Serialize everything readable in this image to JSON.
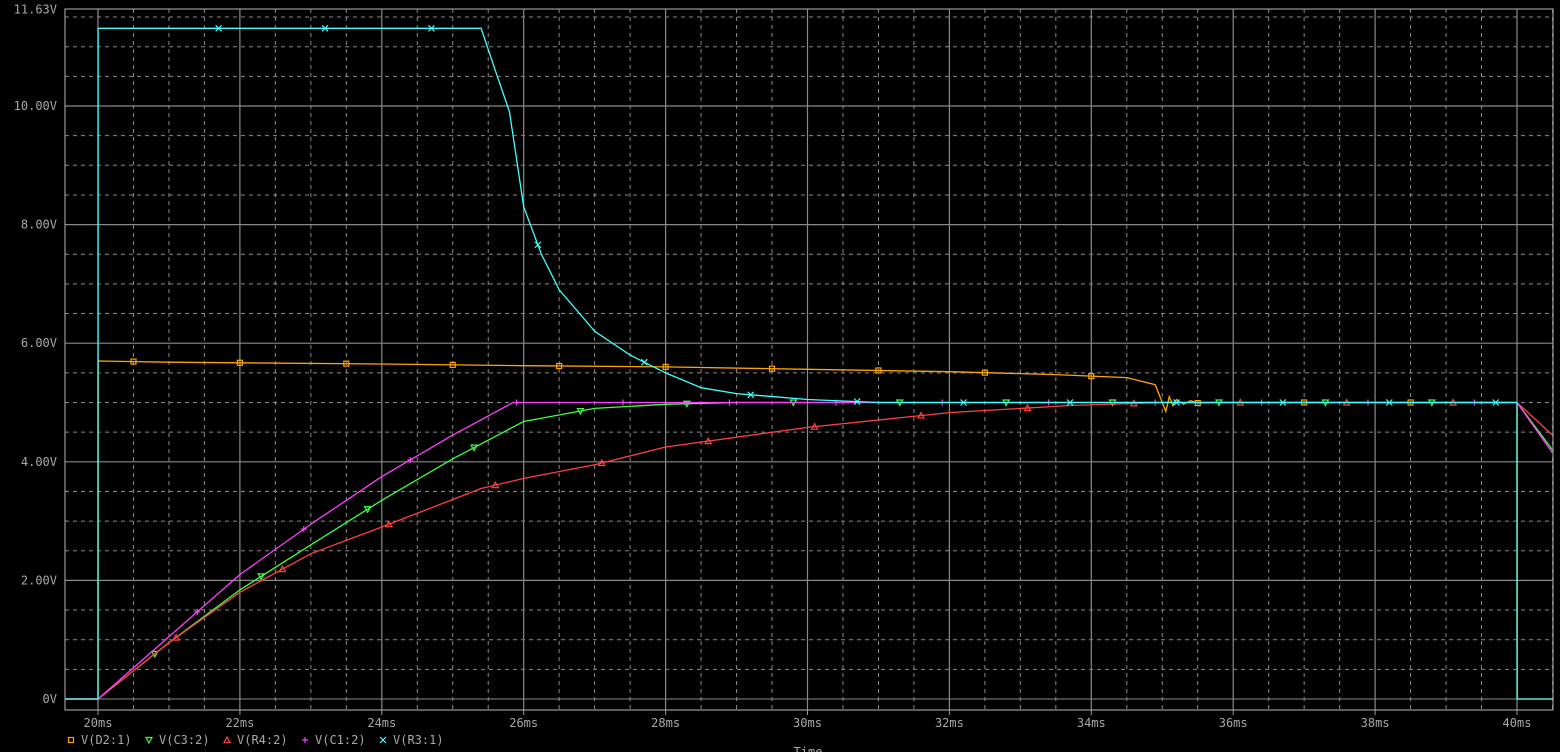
{
  "chart_data": {
    "type": "line",
    "xlabel": "Time",
    "ylabel": "",
    "xlim": [
      19.535,
      40.5
    ],
    "ylim": [
      0,
      11.63
    ],
    "grid": true,
    "legend_position": "bottom-left",
    "yticks": [
      {
        "value": 0,
        "label": "0V"
      },
      {
        "value": 2,
        "label": "2.00V"
      },
      {
        "value": 4,
        "label": "4.00V"
      },
      {
        "value": 6,
        "label": "6.00V"
      },
      {
        "value": 8,
        "label": "8.00V"
      },
      {
        "value": 10,
        "label": "10.00V"
      },
      {
        "value": 11.63,
        "label": "11.63V"
      }
    ],
    "xticks": [
      {
        "value": 20,
        "label": "20ms"
      },
      {
        "value": 22,
        "label": "22ms"
      },
      {
        "value": 24,
        "label": "24ms"
      },
      {
        "value": 26,
        "label": "26ms"
      },
      {
        "value": 28,
        "label": "28ms"
      },
      {
        "value": 30,
        "label": "30ms"
      },
      {
        "value": 32,
        "label": "32ms"
      },
      {
        "value": 34,
        "label": "34ms"
      },
      {
        "value": 36,
        "label": "36ms"
      },
      {
        "value": 38,
        "label": "38ms"
      },
      {
        "value": 40,
        "label": "40ms"
      }
    ],
    "series": [
      {
        "name": "V(D2:1)",
        "color": "#ffa500",
        "marker": "square",
        "x": [
          19.535,
          20,
          20.001,
          21,
          24,
          26,
          28,
          30,
          32,
          33.5,
          34.5,
          34.9,
          35.0,
          35.05,
          35.1,
          35.15,
          35.2,
          35.3,
          35.4,
          35.5,
          35.7,
          40,
          40.001,
          40.5
        ],
        "y": [
          0,
          0,
          5.7,
          5.68,
          5.65,
          5.62,
          5.6,
          5.56,
          5.52,
          5.47,
          5.42,
          5.3,
          5.0,
          4.85,
          5.1,
          4.95,
          5.05,
          4.97,
          5.03,
          4.99,
          5.0,
          5.0,
          0,
          0
        ]
      },
      {
        "name": "V(C3:2)",
        "color": "#40ff40",
        "marker": "triangle-down",
        "x": [
          19.535,
          20,
          21,
          22,
          23,
          24,
          25,
          26,
          27,
          28,
          29,
          40,
          40.5
        ],
        "y": [
          0,
          0,
          0.95,
          1.84,
          2.6,
          3.35,
          4.05,
          4.68,
          4.9,
          4.97,
          5.0,
          5.0,
          4.2
        ]
      },
      {
        "name": "V(R4:2)",
        "color": "#ff4040",
        "marker": "triangle-up",
        "x": [
          19.535,
          20,
          21,
          22,
          23,
          24,
          25.4,
          26,
          27,
          28,
          30,
          32,
          33.7,
          35,
          40,
          40.5
        ],
        "y": [
          0,
          0,
          0.95,
          1.8,
          2.45,
          2.9,
          3.55,
          3.72,
          3.95,
          4.25,
          4.58,
          4.83,
          4.95,
          5.0,
          5.0,
          4.45
        ]
      },
      {
        "name": "V(C1:2)",
        "color": "#ff40ff",
        "marker": "plus",
        "x": [
          19.535,
          20,
          21,
          22,
          23,
          24,
          25,
          25.85,
          40,
          40.5
        ],
        "y": [
          0,
          0,
          1.05,
          2.1,
          2.95,
          3.75,
          4.45,
          5.0,
          5.0,
          4.15
        ]
      },
      {
        "name": "V(R3:1)",
        "color": "#40ffff",
        "marker": "x",
        "x": [
          19.535,
          20,
          20.001,
          25.4,
          25.6,
          25.8,
          26,
          26.25,
          26.5,
          27,
          27.5,
          28,
          28.5,
          29,
          30,
          31,
          40,
          40.001,
          40.5
        ],
        "y": [
          0,
          0,
          11.31,
          11.31,
          10.6,
          9.9,
          8.3,
          7.5,
          6.9,
          6.2,
          5.8,
          5.5,
          5.25,
          5.15,
          5.05,
          5.0,
          5.0,
          0,
          0
        ]
      }
    ]
  }
}
